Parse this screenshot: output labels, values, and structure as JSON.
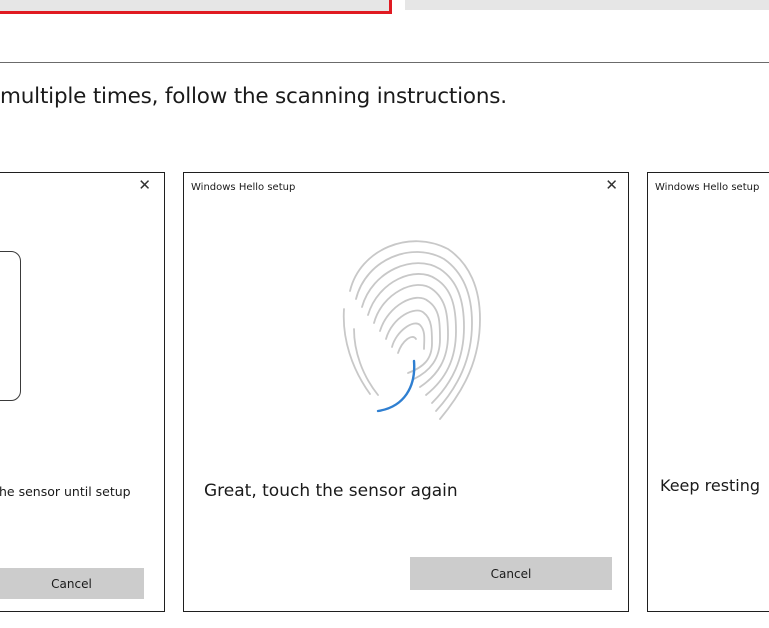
{
  "instruction_text": "multiple times, follow the scanning instructions.",
  "dialogs": [
    {
      "close_glyph": "✕",
      "message": "he sensor until setup",
      "cancel_label": "Cancel"
    },
    {
      "title": "Windows Hello setup",
      "close_glyph": "✕",
      "message": "Great, touch the sensor again",
      "cancel_label": "Cancel",
      "icon": "fingerprint-icon",
      "accent_color": "#2f7fd1"
    },
    {
      "title": "Windows Hello setup",
      "message": "Keep resting"
    }
  ],
  "colors": {
    "highlight_border": "#e01a22",
    "button_bg": "#cccccc"
  }
}
